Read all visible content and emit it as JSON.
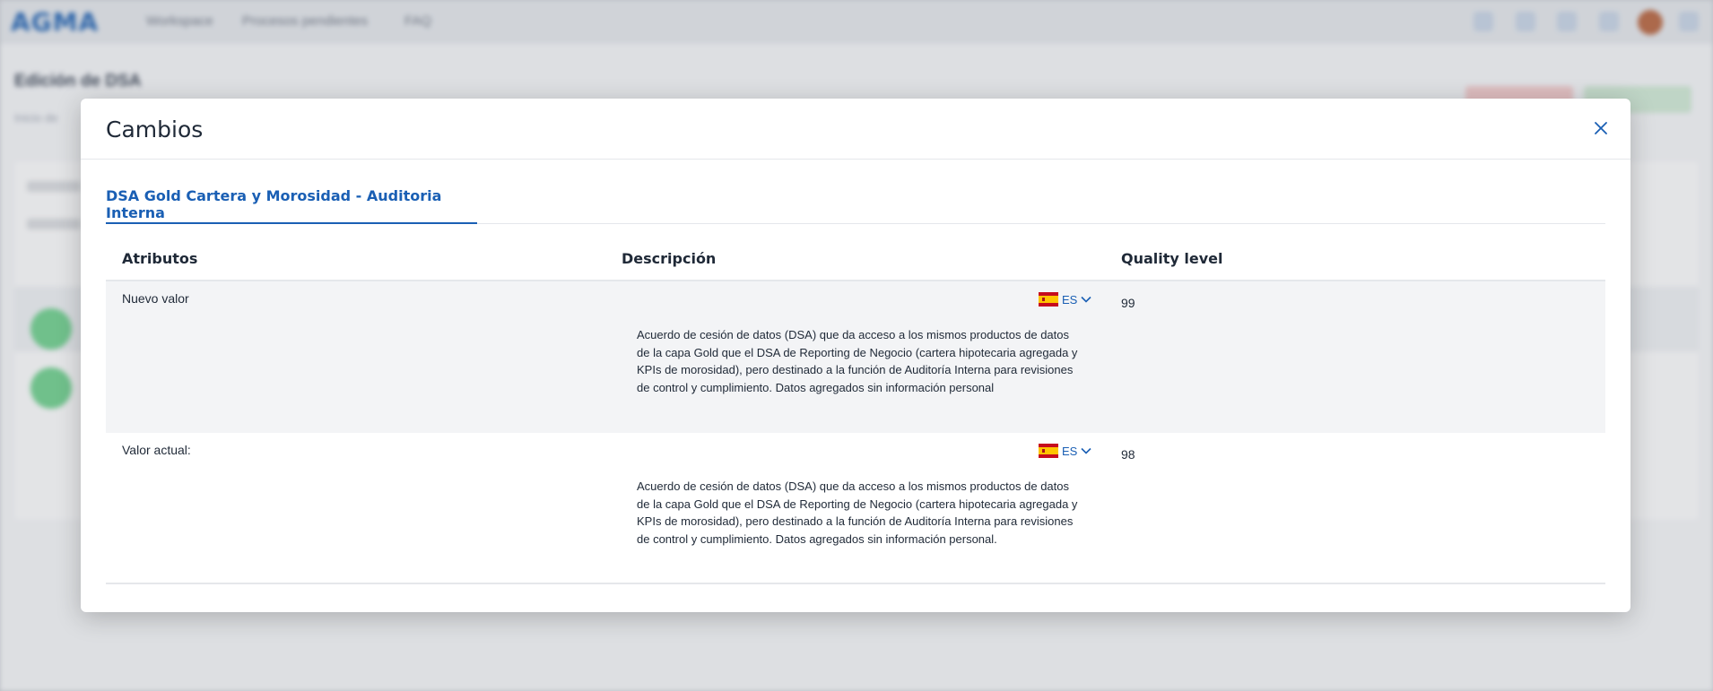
{
  "background": {
    "logo": "AGMA",
    "nav": [
      "Workspace",
      "Procesos pendientes",
      "FAQ"
    ],
    "page_title": "Edición de DSA",
    "page_subtitle": "Inicio de"
  },
  "modal": {
    "title": "Cambios",
    "close_icon": "close-icon",
    "tabs": [
      {
        "label": "DSA Gold Cartera y Morosidad - Auditoria Interna",
        "active": true
      }
    ],
    "columns": [
      "Atributos",
      "Descripción",
      "Quality level"
    ],
    "rows": [
      {
        "label": "Nuevo valor",
        "lang": {
          "flag": "spain-flag-icon",
          "code": "ES"
        },
        "description": "Acuerdo de cesión de datos (DSA) que da acceso a los mismos productos de datos de la capa Gold que el DSA de Reporting de Negocio (cartera hipotecaria agregada y KPIs de morosidad), pero destinado a la función de Auditoría Interna para revisiones de control y cumplimiento. Datos agregados sin información personal",
        "quality_level": "99"
      },
      {
        "label": "Valor actual:",
        "lang": {
          "flag": "spain-flag-icon",
          "code": "ES"
        },
        "description": "Acuerdo de cesión de datos (DSA) que da acceso a los mismos productos de datos de la capa Gold que el DSA de Reporting de Negocio (cartera hipotecaria agregada y KPIs de morosidad), pero destinado a la función de Auditoría Interna para revisiones de control y cumplimiento. Datos agregados sin información personal.",
        "quality_level": "98"
      }
    ]
  },
  "colors": {
    "accent": "#1a5fb4",
    "row_alt_bg": "#f3f4f6",
    "flag_red": "#c60b1e",
    "flag_yellow": "#ffc400"
  }
}
